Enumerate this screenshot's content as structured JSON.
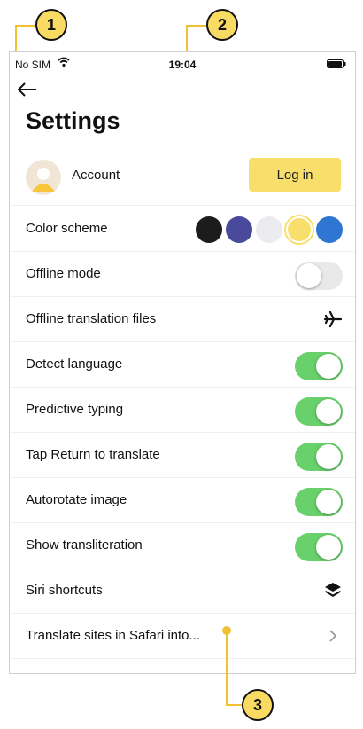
{
  "status_bar": {
    "carrier": "No SIM",
    "time": "19:04"
  },
  "page": {
    "title": "Settings"
  },
  "account": {
    "label": "Account",
    "login_label": "Log in"
  },
  "color_scheme": {
    "label": "Color scheme",
    "swatches": [
      "#1c1c1c",
      "#4a4a9c",
      "#ececf0",
      "#f8df6b",
      "#2f76d2"
    ],
    "selected_index": 3
  },
  "rows": {
    "offline_mode": {
      "label": "Offline mode",
      "on": false
    },
    "offline_files": {
      "label": "Offline translation files",
      "icon": "airplane-icon"
    },
    "detect_language": {
      "label": "Detect language",
      "on": true
    },
    "predictive_typing": {
      "label": "Predictive typing",
      "on": true
    },
    "tap_return": {
      "label": "Tap Return to translate",
      "on": true
    },
    "autorotate": {
      "label": "Autorotate image",
      "on": true
    },
    "transliteration": {
      "label": "Show transliteration",
      "on": true
    },
    "siri": {
      "label": "Siri shortcuts",
      "icon": "layers-icon"
    },
    "safari": {
      "label": "Translate sites in Safari into...",
      "icon": "chevron-right-icon"
    }
  },
  "callouts": [
    "1",
    "2",
    "3"
  ],
  "colors": {
    "toggle_on": "#68d16b",
    "accent": "#f8df6b",
    "callout": "#f9da62"
  }
}
